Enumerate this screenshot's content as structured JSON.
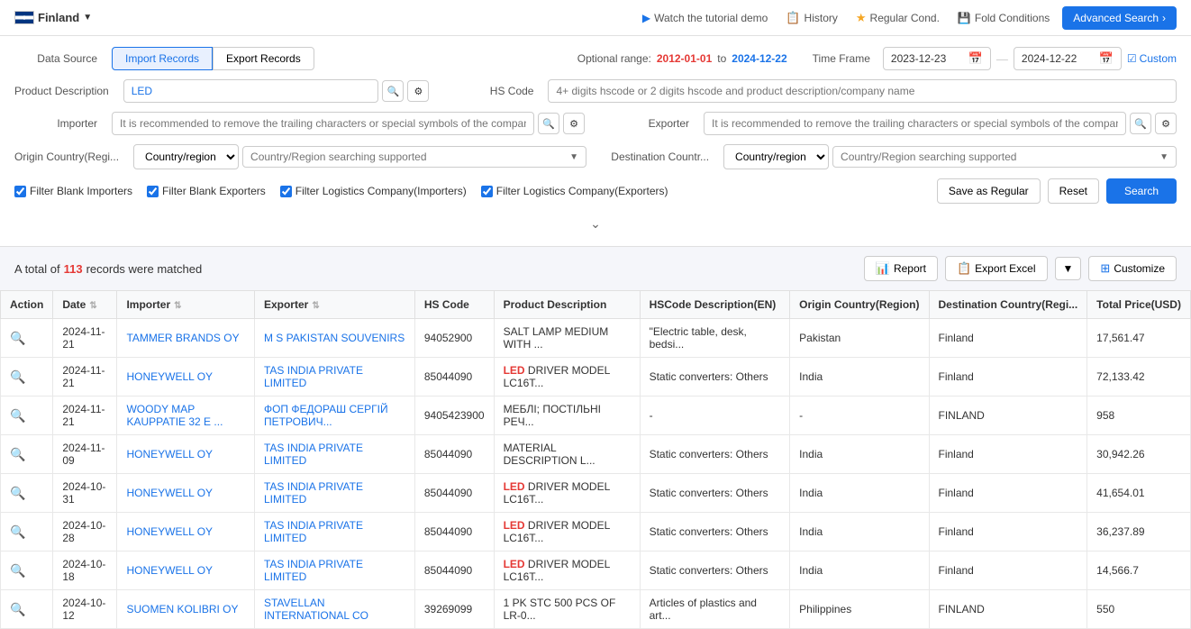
{
  "topbar": {
    "country": "Finland",
    "links": [
      {
        "id": "tutorial",
        "label": "Watch the tutorial demo",
        "icon": "▶"
      },
      {
        "id": "history",
        "label": "History",
        "icon": "📋"
      },
      {
        "id": "regular_cond",
        "label": "Regular Cond.",
        "icon": "⭐"
      },
      {
        "id": "fold_conditions",
        "label": "Fold Conditions",
        "icon": "💾"
      }
    ],
    "advanced_search": "Advanced Search"
  },
  "search": {
    "data_source": {
      "label": "Data Source",
      "options": [
        "Import Records",
        "Export Records"
      ],
      "active": "Import Records"
    },
    "optional_range_label": "Optional range:",
    "range_start": "2012-01-01",
    "range_end": "2024-12-22",
    "timeframe_label": "Time Frame",
    "timeframe_start": "2023-12-23",
    "timeframe_end": "2024-12-22",
    "custom_label": "Custom",
    "product_desc_label": "Product Description",
    "product_desc_value": "LED",
    "product_desc_placeholder": "",
    "hs_code_label": "HS Code",
    "hs_code_placeholder": "4+ digits hscode or 2 digits hscode and product description/company name",
    "importer_label": "Importer",
    "importer_placeholder": "It is recommended to remove the trailing characters or special symbols of the company",
    "exporter_label": "Exporter",
    "exporter_placeholder": "It is recommended to remove the trailing characters or special symbols of the company",
    "origin_country_label": "Origin Country(Regi...",
    "origin_country_type": "Country/region",
    "origin_country_placeholder": "Country/Region searching supported",
    "destination_country_label": "Destination Countr...",
    "destination_country_type": "Country/region",
    "destination_country_placeholder": "Country/Region searching supported",
    "checkboxes": [
      {
        "id": "filter_blank_importers",
        "label": "Filter Blank Importers",
        "checked": true
      },
      {
        "id": "filter_blank_exporters",
        "label": "Filter Blank Exporters",
        "checked": true
      },
      {
        "id": "filter_logistics_importers",
        "label": "Filter Logistics Company(Importers)",
        "checked": true
      },
      {
        "id": "filter_logistics_exporters",
        "label": "Filter Logistics Company(Exporters)",
        "checked": true
      }
    ],
    "save_btn": "Save as Regular",
    "reset_btn": "Reset",
    "search_btn": "Search"
  },
  "results": {
    "prefix": "A total of",
    "count": "113",
    "suffix": "records were matched",
    "report_btn": "Report",
    "export_btn": "Export Excel",
    "customize_btn": "Customize"
  },
  "table": {
    "columns": [
      {
        "id": "action",
        "label": "Action"
      },
      {
        "id": "date",
        "label": "Date",
        "sortable": true
      },
      {
        "id": "importer",
        "label": "Importer",
        "sortable": true
      },
      {
        "id": "exporter",
        "label": "Exporter",
        "sortable": true
      },
      {
        "id": "hs_code",
        "label": "HS Code"
      },
      {
        "id": "product_desc",
        "label": "Product Description"
      },
      {
        "id": "hscode_desc_en",
        "label": "HSCode Description(EN)"
      },
      {
        "id": "origin_country",
        "label": "Origin Country(Region)"
      },
      {
        "id": "dest_country",
        "label": "Destination Country(Regi..."
      },
      {
        "id": "total_price",
        "label": "Total Price(USD)"
      }
    ],
    "rows": [
      {
        "action": "🔍",
        "date": "2024-11-21",
        "importer": "TAMMER BRANDS OY",
        "exporter": "M S PAKISTAN SOUVENIRS",
        "hs_code": "94052900",
        "product_desc": "SALT LAMP MEDIUM WITH ...",
        "product_desc_highlight": false,
        "hscode_desc_en": "\"Electric table, desk, bedsi...",
        "origin_country": "Pakistan",
        "dest_country": "Finland",
        "total_price": "17,561.47"
      },
      {
        "action": "🔍",
        "date": "2024-11-21",
        "importer": "HONEYWELL OY",
        "exporter": "TAS INDIA PRIVATE LIMITED",
        "hs_code": "85044090",
        "product_desc": "LED DRIVER MODEL LC16T...",
        "product_desc_highlight": true,
        "hscode_desc_en": "Static converters: Others",
        "origin_country": "India",
        "dest_country": "Finland",
        "total_price": "72,133.42"
      },
      {
        "action": "🔍",
        "date": "2024-11-21",
        "importer": "WOODY MAP KAUPPATIE 32 E ...",
        "exporter": "ФОП ФЕДОРАШ СЕРГІЙ ПЕТРОВИЧ...",
        "hs_code": "9405423900",
        "product_desc": "МЕБЛІ; ПОСТІЛЬНІ РЕЧ...",
        "product_desc_highlight": false,
        "hscode_desc_en": "-",
        "origin_country": "-",
        "dest_country": "FINLAND",
        "total_price": "958"
      },
      {
        "action": "🔍",
        "date": "2024-11-09",
        "importer": "HONEYWELL OY",
        "exporter": "TAS INDIA PRIVATE LIMITED",
        "hs_code": "85044090",
        "product_desc": "MATERIAL DESCRIPTION L...",
        "product_desc_highlight": false,
        "hscode_desc_en": "Static converters: Others",
        "origin_country": "India",
        "dest_country": "Finland",
        "total_price": "30,942.26"
      },
      {
        "action": "🔍",
        "date": "2024-10-31",
        "importer": "HONEYWELL OY",
        "exporter": "TAS INDIA PRIVATE LIMITED",
        "hs_code": "85044090",
        "product_desc": "LED DRIVER MODEL LC16T...",
        "product_desc_highlight": true,
        "hscode_desc_en": "Static converters: Others",
        "origin_country": "India",
        "dest_country": "Finland",
        "total_price": "41,654.01"
      },
      {
        "action": "🔍",
        "date": "2024-10-28",
        "importer": "HONEYWELL OY",
        "exporter": "TAS INDIA PRIVATE LIMITED",
        "hs_code": "85044090",
        "product_desc": "LED DRIVER MODEL LC16T...",
        "product_desc_highlight": true,
        "hscode_desc_en": "Static converters: Others",
        "origin_country": "India",
        "dest_country": "Finland",
        "total_price": "36,237.89"
      },
      {
        "action": "🔍",
        "date": "2024-10-18",
        "importer": "HONEYWELL OY",
        "exporter": "TAS INDIA PRIVATE LIMITED",
        "hs_code": "85044090",
        "product_desc": "LED DRIVER MODEL LC16T...",
        "product_desc_highlight": true,
        "hscode_desc_en": "Static converters: Others",
        "origin_country": "India",
        "dest_country": "Finland",
        "total_price": "14,566.7"
      },
      {
        "action": "🔍",
        "date": "2024-10-12",
        "importer": "SUOMEN KOLIBRI OY",
        "exporter": "STAVELLAN INTERNATIONAL CO",
        "hs_code": "39269099",
        "product_desc": "1 PK STC 500 PCS OF LR-0...",
        "product_desc_highlight": false,
        "hscode_desc_en": "Articles of plastics and art...",
        "origin_country": "Philippines",
        "dest_country": "FINLAND",
        "total_price": "550"
      }
    ]
  }
}
